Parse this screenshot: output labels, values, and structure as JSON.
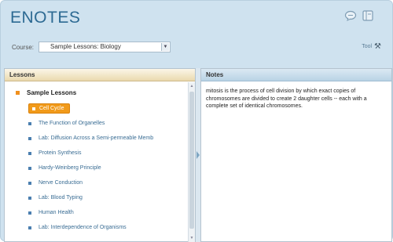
{
  "app": {
    "title": "ENOTES"
  },
  "header_icons": [
    "chat-bubble-icon",
    "book-icon"
  ],
  "course": {
    "label": "Course:",
    "selected": "Sample Lessons: Biology"
  },
  "tools": {
    "label": "Tool"
  },
  "lessons_panel": {
    "header": "Lessons",
    "root": "Sample Lessons",
    "items": [
      {
        "label": "Cell Cycle",
        "selected": true
      },
      {
        "label": "The Function of Organelles"
      },
      {
        "label": "Lab: Diffusion Across a Semi-permeable Memb"
      },
      {
        "label": "Protein Synthesis"
      },
      {
        "label": "Hardy-Weinberg Principle"
      },
      {
        "label": "Nerve Conduction"
      },
      {
        "label": "Lab: Blood Typing"
      },
      {
        "label": "Human Health"
      },
      {
        "label": "Lab: Interdependence of Organisms"
      }
    ]
  },
  "notes_panel": {
    "header": "Notes",
    "text": "mitosis is the process of cell division by which exact copies of chromosomes are divided to create 2 daughter cells -- each with a complete set of identical chromosomes."
  },
  "colors": {
    "accent": "#f19a1a",
    "title": "#2d6a93",
    "background": "#cfe2ef"
  }
}
